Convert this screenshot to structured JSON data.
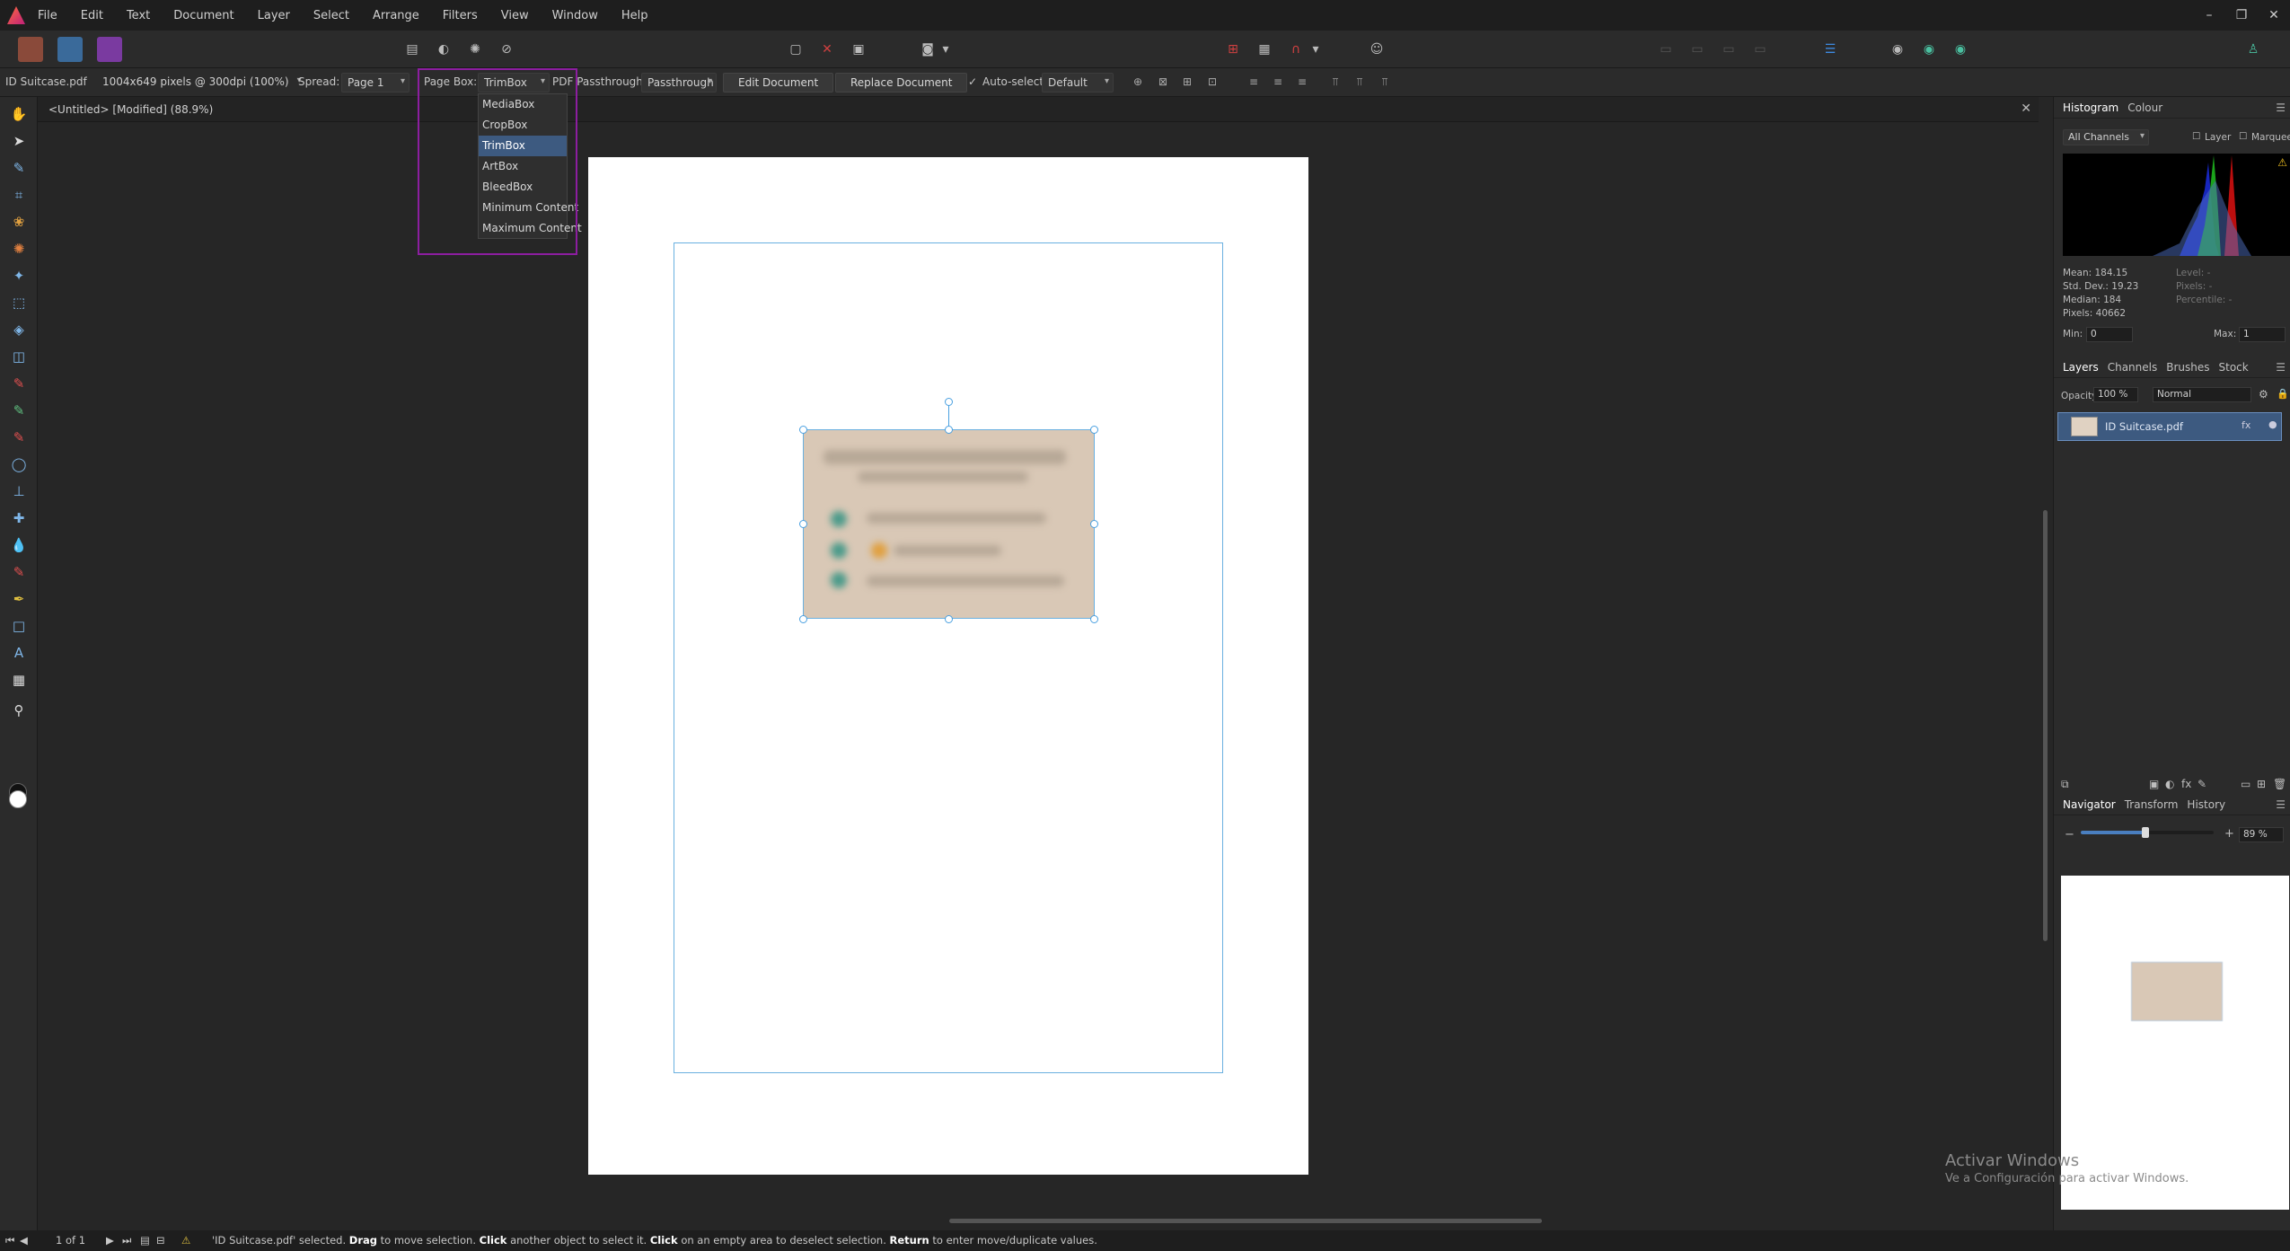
{
  "menubar": {
    "items": [
      "File",
      "Edit",
      "Text",
      "Document",
      "Layer",
      "Select",
      "Arrange",
      "Filters",
      "View",
      "Window",
      "Help"
    ],
    "window_controls": [
      "–",
      "❐",
      "✕"
    ]
  },
  "context": {
    "doc_name": "ID Suitcase.pdf",
    "size_info": "1004x649 pixels @ 300dpi (100%)",
    "spread_label": "Spread:",
    "spread_value": "Page 1",
    "pagebox_label": "Page Box:",
    "pagebox_value": "TrimBox",
    "pdf_label": "PDF Passthrough:",
    "pdf_value": "Passthrough",
    "edit_document": "Edit Document",
    "replace_document": "Replace Document",
    "autoselect_label": "Auto-select:",
    "autoselect_value": "Default"
  },
  "pagebox_menu": {
    "options": [
      "MediaBox",
      "CropBox",
      "TrimBox",
      "ArtBox",
      "BleedBox",
      "Minimum Content",
      "Maximum Content"
    ],
    "selected": "TrimBox"
  },
  "doctab": {
    "title": "<Untitled> [Modified] (88.9%)",
    "close": "✕"
  },
  "histogram_panel": {
    "tabs": [
      "Histogram",
      "Colour"
    ],
    "channel": "All Channels",
    "layer_label": "Layer",
    "marquee_label": "Marquee",
    "mean": "Mean: 184.15",
    "stddev": "Std. Dev.: 19.23",
    "median": "Median: 184",
    "pixels": "Pixels: 40662",
    "level": "Level: -",
    "pixels2": "Pixels: -",
    "percentile": "Percentile: -",
    "min_label": "Min:",
    "min_value": "0",
    "max_label": "Max:",
    "max_value": "1"
  },
  "layers_panel": {
    "tabs": [
      "Layers",
      "Channels",
      "Brushes",
      "Stock"
    ],
    "opacity_label": "Opacity:",
    "opacity_value": "100 %",
    "blend_mode": "Normal",
    "layer_name": "ID Suitcase.pdf"
  },
  "navigator_panel": {
    "tabs": [
      "Navigator",
      "Transform",
      "History"
    ],
    "zoom": "89 %"
  },
  "watermark": {
    "title": "Activar Windows",
    "subtitle": "Ve a Configuración para activar Windows."
  },
  "status": {
    "page": "1 of 1",
    "msg_1": "'ID Suitcase.pdf' selected.",
    "drag": "Drag",
    "msg_2": "to move selection.",
    "click": "Click",
    "msg_3": "another object to select it.",
    "click2": "Click",
    "msg_4": "on an empty area to deselect selection.",
    "return": "Return",
    "msg_5": "to enter move/duplicate values."
  },
  "colors": {
    "accent": "#3d5a80",
    "highlight": "#8c1ea0",
    "selection": "#4aa0e0"
  }
}
